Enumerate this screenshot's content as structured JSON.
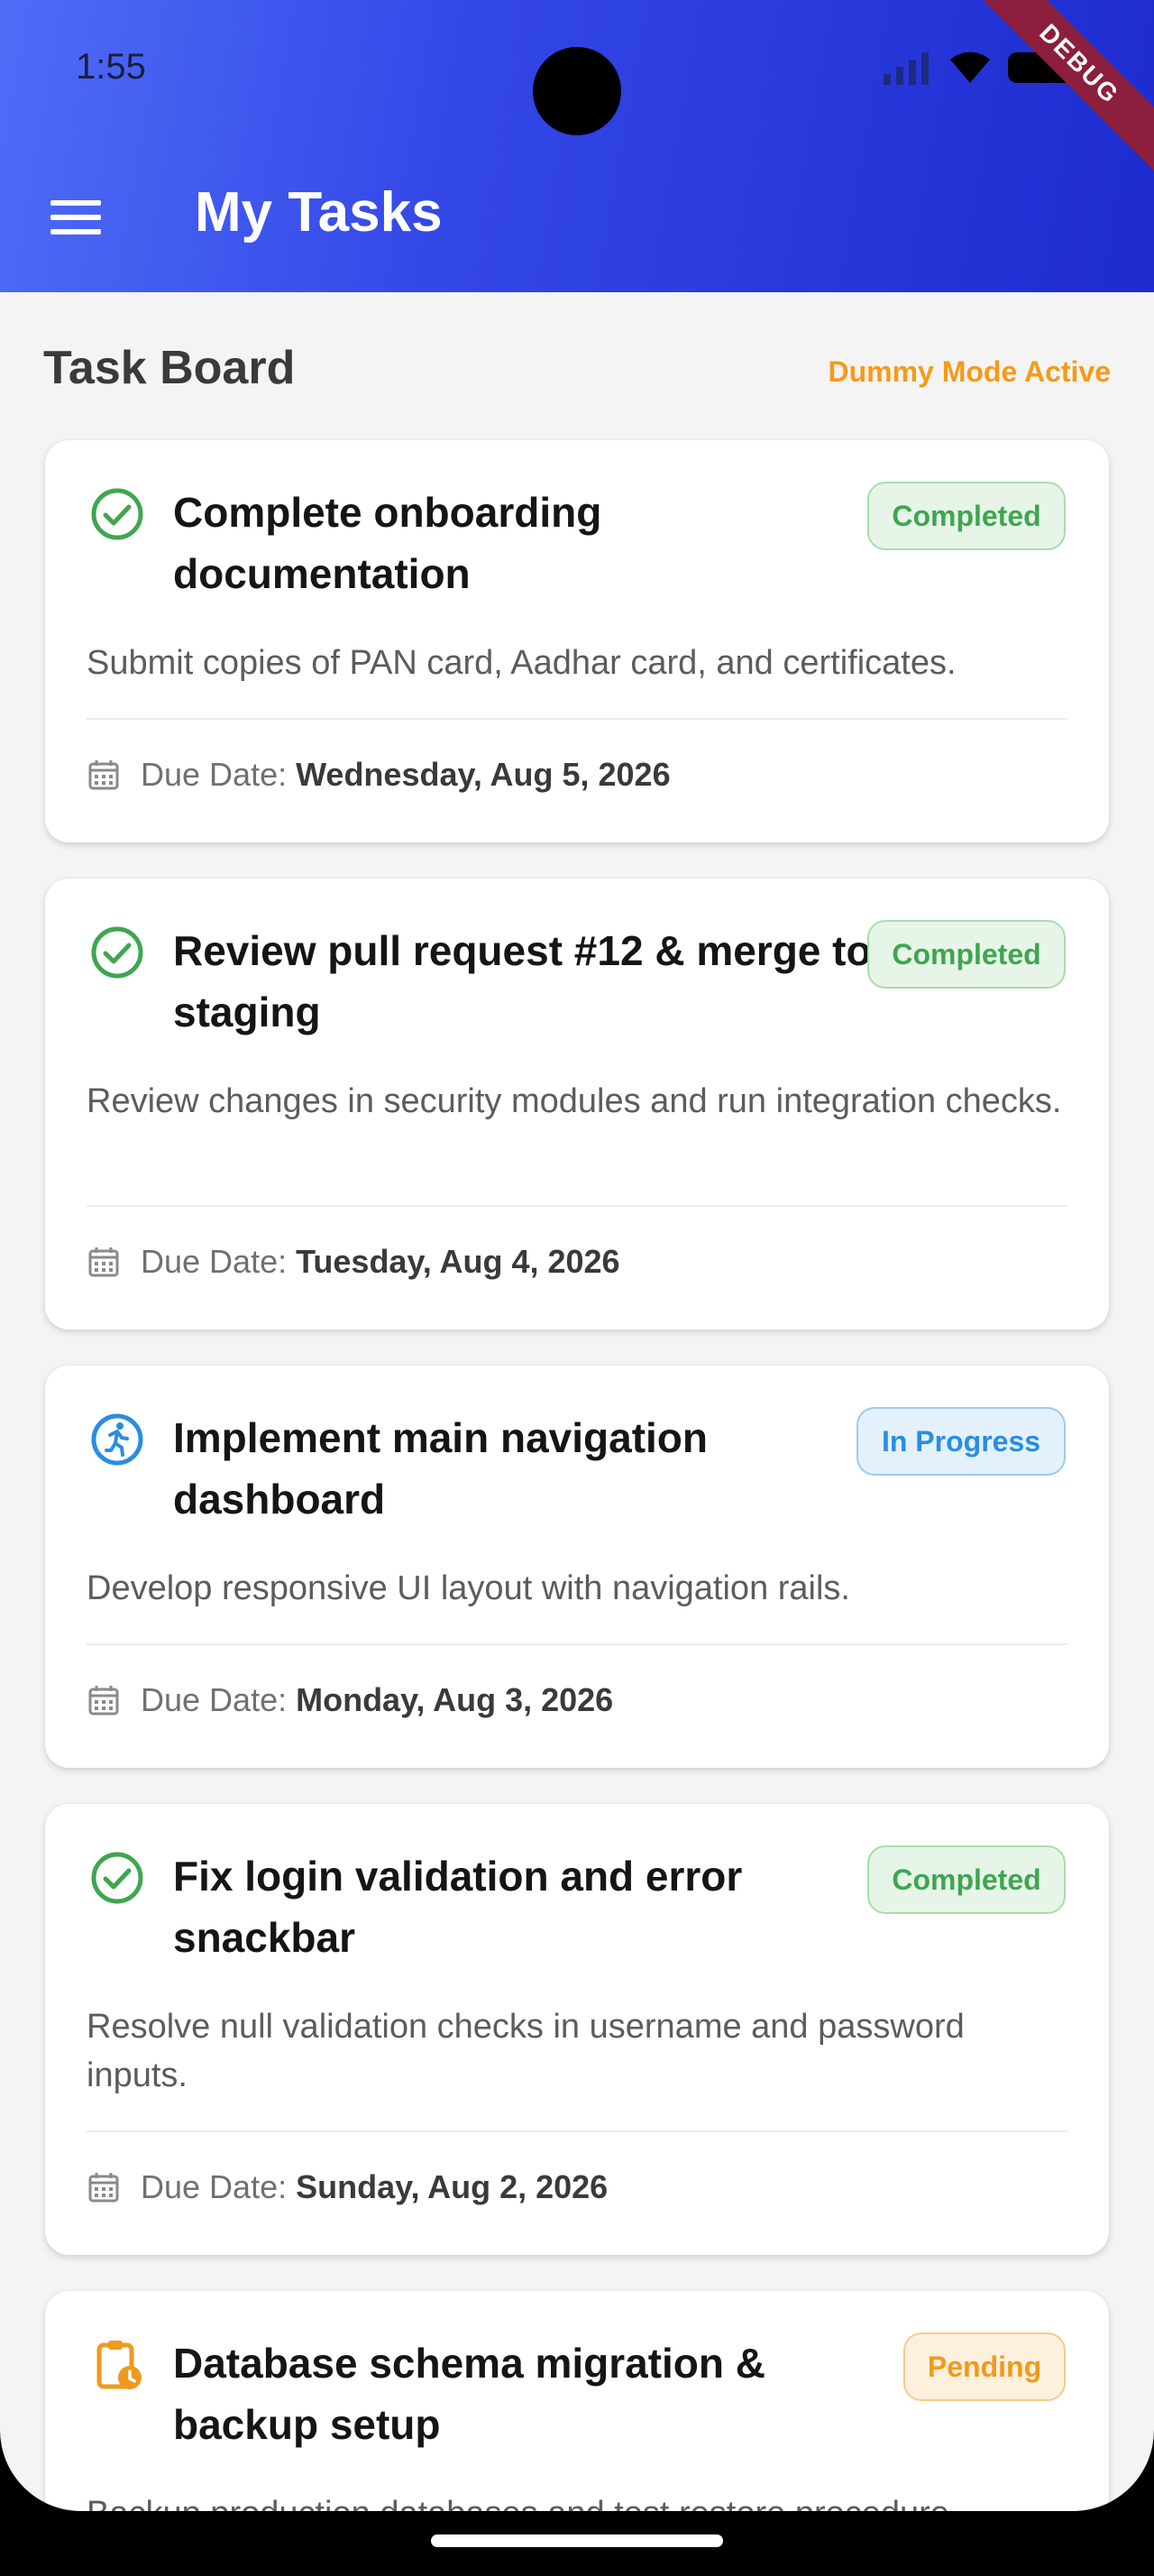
{
  "status_bar": {
    "time": "1:55"
  },
  "debug_ribbon": "DEBUG",
  "app_bar": {
    "title": "My Tasks"
  },
  "board": {
    "title": "Task Board",
    "mode_label": "Dummy Mode Active"
  },
  "colors": {
    "completed": "#3fa650",
    "in_progress": "#2b8de0",
    "pending": "#ef9a1c",
    "app_bar": "#3347e6"
  },
  "tasks": [
    {
      "icon": "check-circle-icon",
      "title": "Complete onboarding documentation",
      "status": "Completed",
      "description": "Submit copies of PAN card, Aadhar card, and certificates.",
      "due_label": "Due Date:",
      "due_date": "Wednesday, Aug 5, 2026"
    },
    {
      "icon": "check-circle-icon",
      "title": "Review pull request #12 & merge to staging",
      "status": "Completed",
      "description": "Review changes in security modules and run integration checks.",
      "due_label": "Due Date:",
      "due_date": "Tuesday, Aug 4, 2026"
    },
    {
      "icon": "running-person-icon",
      "title": "Implement main navigation dashboard",
      "status": "In Progress",
      "description": "Develop responsive UI layout with navigation rails.",
      "due_label": "Due Date:",
      "due_date": "Monday, Aug 3, 2026"
    },
    {
      "icon": "check-circle-icon",
      "title": "Fix login validation and error snackbar",
      "status": "Completed",
      "description": "Resolve null validation checks in username and password inputs.",
      "due_label": "Due Date:",
      "due_date": "Sunday, Aug 2, 2026"
    },
    {
      "icon": "pending-clipboard-icon",
      "title": "Database schema migration & backup setup",
      "status": "Pending",
      "description": "Backup production databases and test restore procedure"
    }
  ]
}
